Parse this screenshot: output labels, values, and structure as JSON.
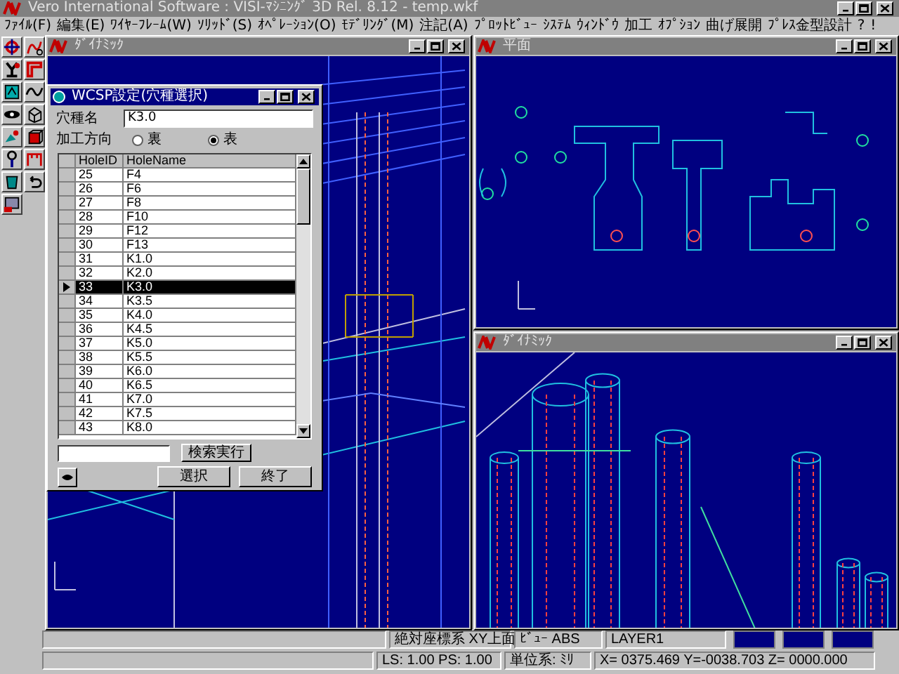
{
  "window": {
    "title": "Vero International Software : VISI-ﾏｼﾆﾝｸﾞ 3D Rel. 8.12 - temp.wkf"
  },
  "menu": [
    "ﾌｧｲﾙ(F)",
    "編集(E)",
    "ﾜｲﾔｰﾌﾚｰﾑ(W)",
    "ｿﾘｯﾄﾞ(S)",
    "ｵﾍﾟﾚｰｼｮﾝ(O)",
    "ﾓﾃﾞﾘﾝｸﾞ(M)",
    "注記(A)",
    "ﾌﾟﾛｯﾄﾋﾞｭｰ",
    "ｼｽﾃﾑ",
    "ｳｨﾝﾄﾞｳ",
    "加工",
    "ｵﾌﾟｼｮﾝ",
    "曲げ展開",
    "ﾌﾟﾚｽ金型設計",
    "?",
    "!"
  ],
  "views": [
    {
      "title": "ﾀﾞｲﾅﾐｯｸ",
      "kind": "block"
    },
    {
      "title": "平面",
      "kind": "plan"
    },
    {
      "title": "ﾀﾞｲﾅﾐｯｸ",
      "kind": "cylinders"
    }
  ],
  "dialog": {
    "title": "WCSP設定(穴種選択)",
    "name_label": "穴種名",
    "name_value": "K3.0",
    "direction_label": "加工方向",
    "direction_options": [
      {
        "label": "裏",
        "selected": false
      },
      {
        "label": "表",
        "selected": true
      }
    ],
    "table": {
      "columns": [
        "HoleID",
        "HoleName"
      ],
      "rows": [
        {
          "cells": [
            "25",
            "F4"
          ],
          "selected": false
        },
        {
          "cells": [
            "26",
            "F6"
          ],
          "selected": false
        },
        {
          "cells": [
            "27",
            "F8"
          ],
          "selected": false
        },
        {
          "cells": [
            "28",
            "F10"
          ],
          "selected": false
        },
        {
          "cells": [
            "29",
            "F12"
          ],
          "selected": false
        },
        {
          "cells": [
            "30",
            "F13"
          ],
          "selected": false
        },
        {
          "cells": [
            "31",
            "K1.0"
          ],
          "selected": false
        },
        {
          "cells": [
            "32",
            "K2.0"
          ],
          "selected": false
        },
        {
          "cells": [
            "33",
            "K3.0"
          ],
          "selected": true
        },
        {
          "cells": [
            "34",
            "K3.5"
          ],
          "selected": false
        },
        {
          "cells": [
            "35",
            "K4.0"
          ],
          "selected": false
        },
        {
          "cells": [
            "36",
            "K4.5"
          ],
          "selected": false
        },
        {
          "cells": [
            "37",
            "K5.0"
          ],
          "selected": false
        },
        {
          "cells": [
            "38",
            "K5.5"
          ],
          "selected": false
        },
        {
          "cells": [
            "39",
            "K6.0"
          ],
          "selected": false
        },
        {
          "cells": [
            "40",
            "K6.5"
          ],
          "selected": false
        },
        {
          "cells": [
            "41",
            "K7.0"
          ],
          "selected": false
        },
        {
          "cells": [
            "42",
            "K7.5"
          ],
          "selected": false
        },
        {
          "cells": [
            "43",
            "K8.0"
          ],
          "selected": false
        }
      ]
    },
    "search_button": "検索実行",
    "buttons": [
      "選択",
      "終了"
    ]
  },
  "status_bar": {
    "row_1": [
      "絶対座標系  XY上面",
      "ﾋﾞｭｰ ABS",
      "LAYER1"
    ],
    "row_2": [
      "LS: 1.00 PS: 1.00",
      "単位系: ﾐﾘ",
      "X= 0375.469 Y=-0038.703 Z= 0000.000"
    ]
  }
}
